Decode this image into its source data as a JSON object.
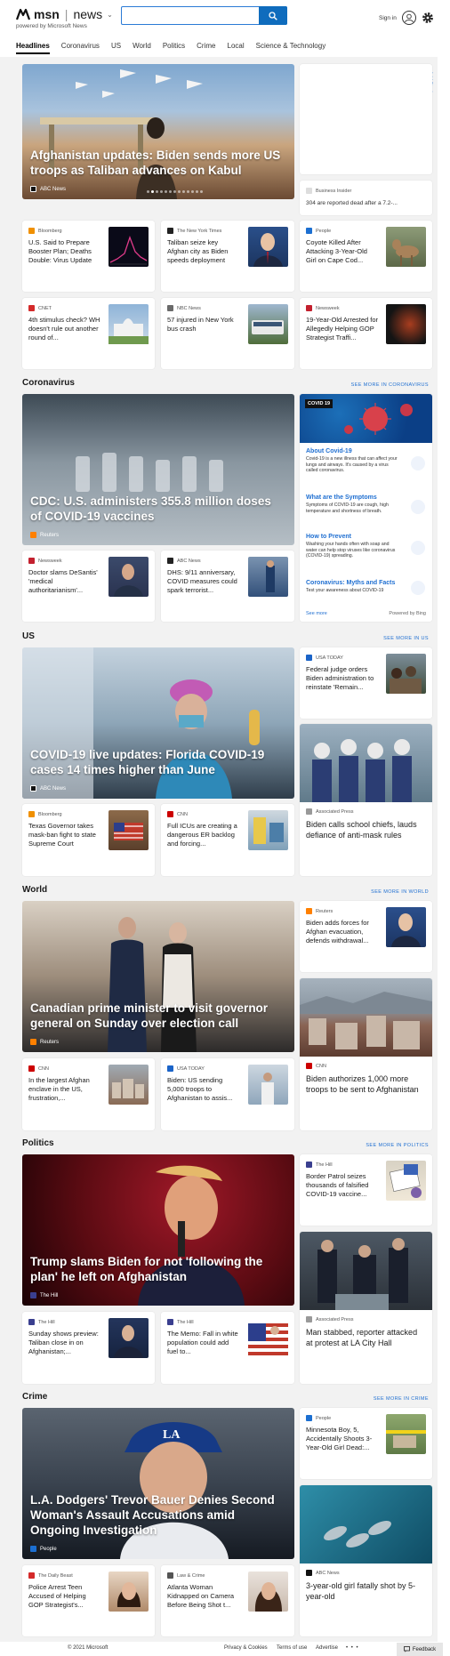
{
  "header": {
    "brand": "msn",
    "section": "news",
    "powered_by": "powered by Microsoft News",
    "search_placeholder": "",
    "signin_label": "Sign in"
  },
  "nav": [
    "Headlines",
    "Coronavirus",
    "US",
    "World",
    "Politics",
    "Crime",
    "Local",
    "Science & Technology"
  ],
  "side_label": "Add Stocks",
  "top": {
    "hero": {
      "title": "Afghanistan updates: Biden sends more US troops as Taliban advances on Kabul",
      "source": "ABC News"
    },
    "right_small": {
      "source": "Business Insider",
      "title": "304 are reported dead after a 7.2-..."
    },
    "cards": [
      {
        "source": "Bloomberg",
        "title": "U.S. Said to Prepare Booster Plan; Deaths Double: Virus Update"
      },
      {
        "source": "The New York Times",
        "title": "Taliban seize key Afghan city as Biden speeds deployment"
      },
      {
        "source": "People",
        "title": "Coyote Killed After Attacking 3-Year-Old Girl on Cape Cod..."
      },
      {
        "source": "CNET",
        "title": "4th stimulus check? WH doesn't rule out another round of..."
      },
      {
        "source": "NBC News",
        "title": "57 injured in New York bus crash"
      },
      {
        "source": "Newsweek",
        "title": "19-Year-Old Arrested for Allegedly Helping GOP Strategist Traffi..."
      }
    ]
  },
  "coronavirus": {
    "heading": "Coronavirus",
    "see_more": "SEE MORE IN CORONAVIRUS",
    "hero": {
      "title": "CDC: U.S. administers 355.8 million doses of COVID-19 vaccines",
      "source": "Reuters"
    },
    "cards": [
      {
        "source": "Newsweek",
        "title": "Doctor slams DeSantis' 'medical authoritarianism'..."
      },
      {
        "source": "ABC News",
        "title": "DHS: 9/11 anniversary, COVID measures could spark terrorist..."
      }
    ],
    "panel": {
      "badge": "COVID 19",
      "sections": [
        {
          "title": "About Covid-19",
          "desc": "Covid-19 is a new illness that can affect your lungs and airways. It's caused by a virus called coronavirus."
        },
        {
          "title": "What are the Symptoms",
          "desc": "Symptoms of COVID-19 are cough, high temperature and shortness of breath."
        },
        {
          "title": "How to Prevent",
          "desc": "Washing your hands often with soap and water can help stop viruses like coronavirus (COVID-19) spreading."
        },
        {
          "title": "Coronavirus: Myths and Facts",
          "desc": "Test your awareness about COVID-19"
        }
      ],
      "see_more": "See more",
      "powered": "Powered by Bing"
    }
  },
  "us": {
    "heading": "US",
    "see_more": "SEE MORE IN US",
    "hero": {
      "title": "COVID-19 live updates: Florida COVID-19 cases 14 times higher than June",
      "source": "ABC News"
    },
    "right_small": {
      "source": "USA TODAY",
      "title": "Federal judge orders Biden administration to reinstate 'Remain..."
    },
    "right_tall": {
      "source": "Associated Press",
      "title": "Biden calls school chiefs, lauds defiance of anti-mask rules"
    },
    "cards": [
      {
        "source": "Bloomberg",
        "title": "Texas Governor takes mask-ban fight to state Supreme Court"
      },
      {
        "source": "CNN",
        "title": "Full ICUs are creating a dangerous ER backlog and forcing..."
      }
    ]
  },
  "world": {
    "heading": "World",
    "see_more": "SEE MORE IN WORLD",
    "hero": {
      "title": "Canadian prime minister to visit governor general on Sunday over election call",
      "source": "Reuters"
    },
    "right_small": {
      "source": "Reuters",
      "title": "Biden adds forces for Afghan evacuation, defends withdrawal..."
    },
    "right_tall": {
      "source": "CNN",
      "title": "Biden authorizes 1,000 more troops to be sent to Afghanistan"
    },
    "cards": [
      {
        "source": "CNN",
        "title": "In the largest Afghan enclave in the US, frustration,..."
      },
      {
        "source": "USA TODAY",
        "title": "Biden: US sending 5,000 troops to Afghanistan to assis..."
      }
    ]
  },
  "politics": {
    "heading": "Politics",
    "see_more": "SEE MORE IN POLITICS",
    "hero": {
      "title": "Trump slams Biden for not 'following the plan' he left on Afghanistan",
      "source": "The Hill"
    },
    "right_small": {
      "source": "The Hill",
      "title": "Border Patrol seizes thousands of falsified COVID-19 vaccine..."
    },
    "right_tall": {
      "source": "Associated Press",
      "title": "Man stabbed, reporter attacked at protest at LA City Hall"
    },
    "cards": [
      {
        "source": "The Hill",
        "title": "Sunday shows preview: Taliban close in on Afghanistan;..."
      },
      {
        "source": "The Hill",
        "title": "The Memo: Fall in white population could add fuel to..."
      }
    ]
  },
  "crime": {
    "heading": "Crime",
    "see_more": "SEE MORE IN CRIME",
    "hero": {
      "title": "L.A. Dodgers' Trevor Bauer Denies Second Woman's Assault Accusations amid Ongoing Investigation",
      "source": "People"
    },
    "right_small": {
      "source": "People",
      "title": "Minnesota Boy, 5, Accidentally Shoots 3-Year-Old Girl Dead:..."
    },
    "right_tall": {
      "source": "ABC News",
      "title": "3-year-old girl fatally shot by 5-year-old"
    },
    "cards": [
      {
        "source": "The Daily Beast",
        "title": "Police Arrest Teen Accused of Helping GOP Strategist's..."
      },
      {
        "source": "Law & Crime",
        "title": "Atlanta Woman Kidnapped on Camera Before Being Shot t..."
      }
    ]
  },
  "footer": {
    "copyright": "© 2021 Microsoft",
    "privacy": "Privacy & Cookies",
    "terms": "Terms of use",
    "advertise": "Advertise",
    "more": "• • •",
    "feedback": "Feedback"
  },
  "colors": {
    "accent": "#0f6cbd",
    "link": "#1f6fd1",
    "page_bg": "#f2f2f2"
  }
}
